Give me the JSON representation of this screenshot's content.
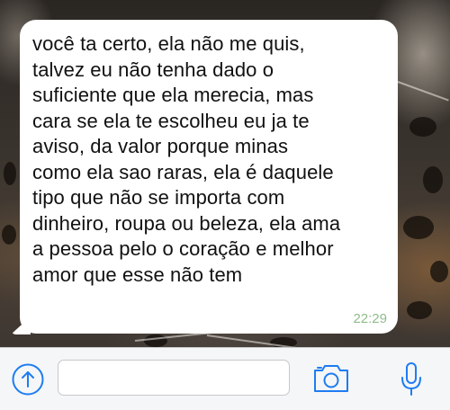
{
  "conversation": {
    "message": {
      "text": "você ta certo, ela não me quis,\ntalvez eu não tenha dado o\nsuficiente que ela merecia, mas\ncara se ela te escolheu eu ja te\naviso, da valor porque minas\ncomo ela sao raras, ela é daquele\ntipo que não se importa com\ndinheiro, roupa ou beleza, ela ama\na pessoa pelo o coração e melhor\namor que esse não tem",
      "time": "22:29"
    }
  },
  "composer": {
    "input_value": "",
    "input_placeholder": ""
  },
  "icons": {
    "upload": "upload-arrow-icon",
    "camera": "camera-icon",
    "microphone": "microphone-icon"
  },
  "colors": {
    "accent": "#1e7cf2",
    "bubble": "#ffffff",
    "timestamp": "#8fbc8a",
    "toolbar": "#f5f6f7"
  }
}
